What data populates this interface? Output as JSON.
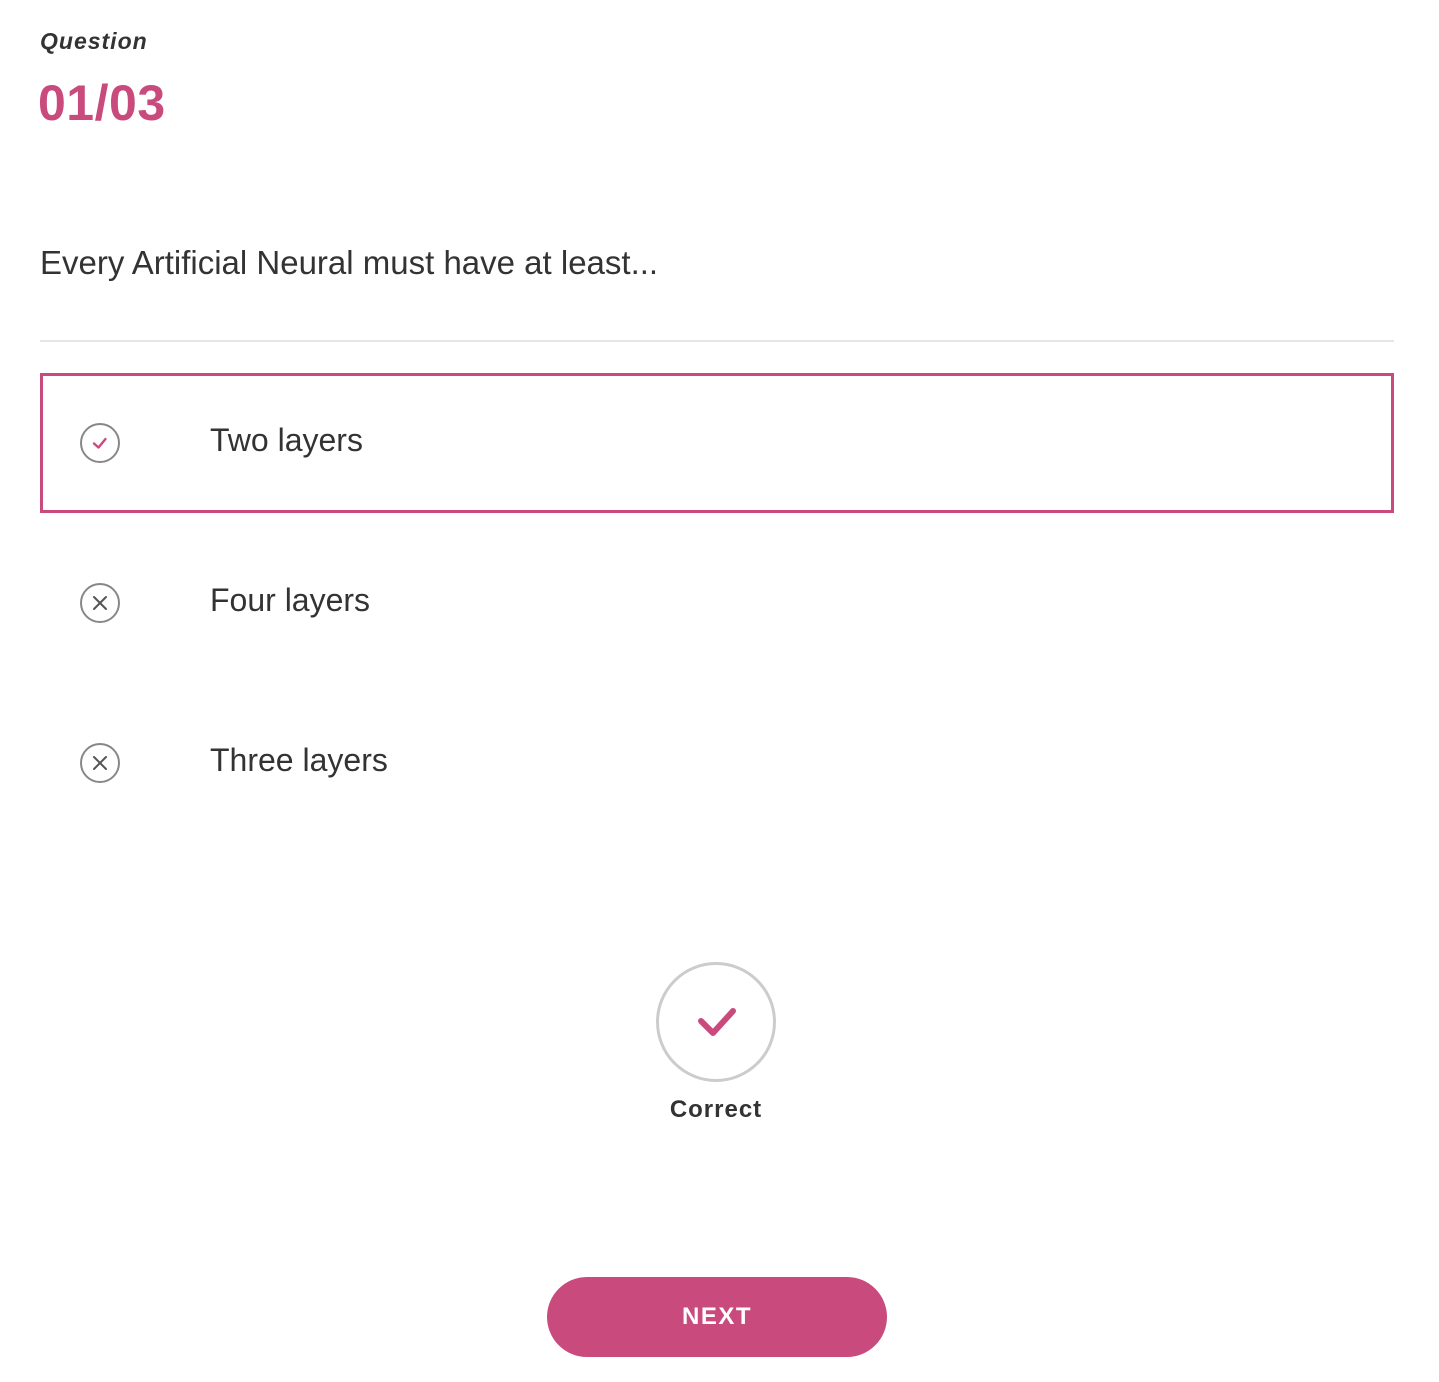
{
  "question": {
    "label": "Question",
    "counter": "01/03",
    "text": "Every Artificial Neural must have at least..."
  },
  "options": [
    {
      "label": "Two layers",
      "icon": "check-circle-icon",
      "selected": true,
      "correct": true
    },
    {
      "label": "Four layers",
      "icon": "x-circle-icon",
      "selected": false,
      "correct": false
    },
    {
      "label": "Three layers",
      "icon": "x-circle-icon",
      "selected": false,
      "correct": false
    }
  ],
  "result": {
    "icon": "checkmark-icon",
    "label": "Correct"
  },
  "next_button": {
    "label": "NEXT"
  },
  "colors": {
    "accent": "#c94a7c",
    "text": "#333333",
    "icon_border": "#888888",
    "divider": "#e6e6e6",
    "result_ring": "#cccccc"
  }
}
